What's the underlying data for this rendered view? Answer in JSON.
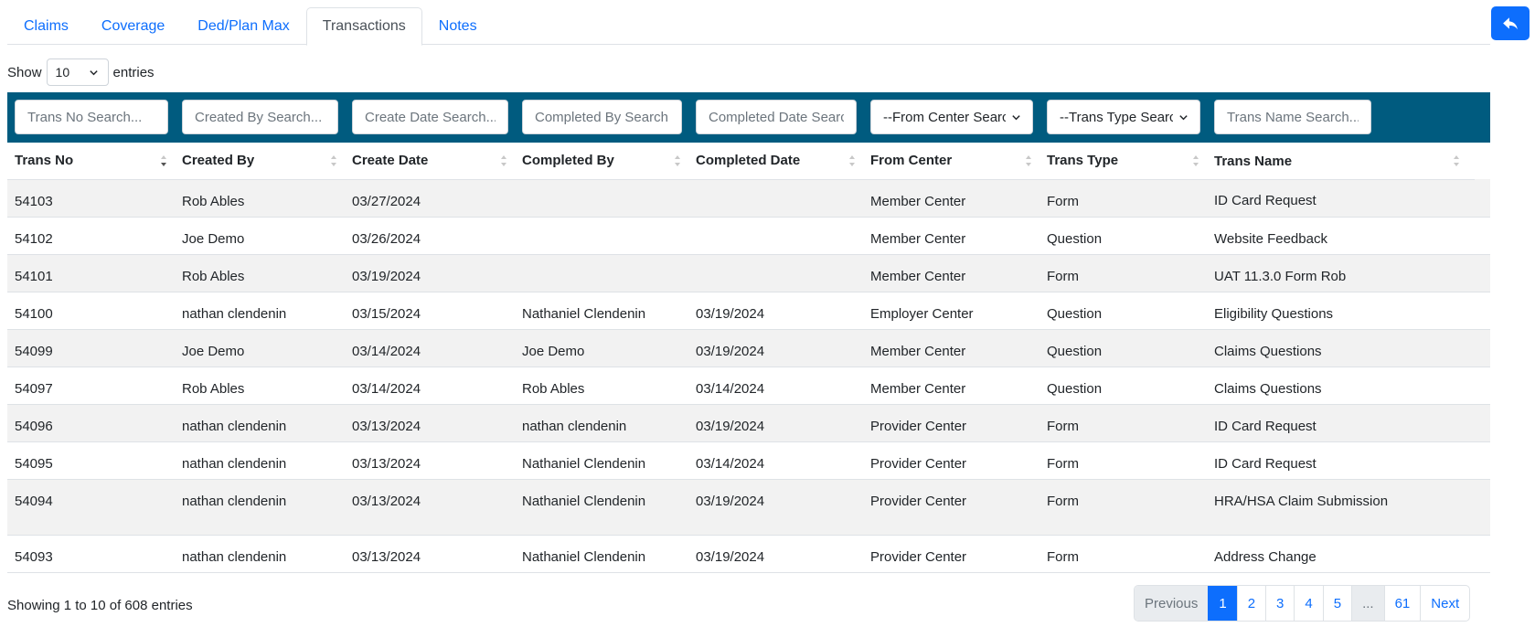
{
  "tabs": [
    {
      "label": "Claims"
    },
    {
      "label": "Coverage"
    },
    {
      "label": "Ded/Plan Max"
    },
    {
      "label": "Transactions"
    },
    {
      "label": "Notes"
    }
  ],
  "length_menu": {
    "show_label": "Show",
    "value": "10",
    "entries_label": "entries"
  },
  "filters": {
    "trans_no": "Trans No Search...",
    "created_by": "Created By Search...",
    "create_date": "Create Date Search...",
    "completed_by": "Completed By Search...",
    "completed_date": "Completed Date Search...",
    "from_center": "--From Center Search--",
    "trans_type": "--Trans Type Search--",
    "trans_name": "Trans Name Search..."
  },
  "columns": [
    "Trans No",
    "Created By",
    "Create Date",
    "Completed By",
    "Completed Date",
    "From Center",
    "Trans Type",
    "Trans Name"
  ],
  "rows": [
    [
      "54103",
      "Rob Ables",
      "03/27/2024",
      "",
      "",
      "Member Center",
      "Form",
      "ID Card Request"
    ],
    [
      "54102",
      "Joe Demo",
      "03/26/2024",
      "",
      "",
      "Member Center",
      "Question",
      "Website Feedback"
    ],
    [
      "54101",
      "Rob Ables",
      "03/19/2024",
      "",
      "",
      "Member Center",
      "Form",
      "UAT 11.3.0 Form Rob"
    ],
    [
      "54100",
      "nathan clendenin",
      "03/15/2024",
      "Nathaniel Clendenin",
      "03/19/2024",
      "Employer Center",
      "Question",
      "Eligibility Questions"
    ],
    [
      "54099",
      "Joe Demo",
      "03/14/2024",
      "Joe Demo",
      "03/19/2024",
      "Member Center",
      "Question",
      "Claims Questions"
    ],
    [
      "54097",
      "Rob Ables",
      "03/14/2024",
      "Rob Ables",
      "03/14/2024",
      "Member Center",
      "Question",
      "Claims Questions"
    ],
    [
      "54096",
      "nathan clendenin",
      "03/13/2024",
      "nathan clendenin",
      "03/19/2024",
      "Provider Center",
      "Form",
      "ID Card Request"
    ],
    [
      "54095",
      "nathan clendenin",
      "03/13/2024",
      "Nathaniel Clendenin",
      "03/14/2024",
      "Provider Center",
      "Form",
      "ID Card Request"
    ],
    [
      "54094",
      "nathan clendenin",
      "03/13/2024",
      "Nathaniel Clendenin",
      "03/19/2024",
      "Provider Center",
      "Form",
      "HRA/HSA Claim Submission"
    ],
    [
      "54093",
      "nathan clendenin",
      "03/13/2024",
      "Nathaniel Clendenin",
      "03/19/2024",
      "Provider Center",
      "Form",
      "Address Change"
    ]
  ],
  "footer": {
    "info": "Showing 1 to 10 of 608 entries",
    "pagination": {
      "previous": "Previous",
      "pages": [
        "1",
        "2",
        "3",
        "4",
        "5"
      ],
      "ellipsis": "...",
      "last": "61",
      "next": "Next"
    }
  },
  "colors": {
    "accent": "#0d6efd",
    "filter_bar": "#005b7f",
    "stripe": "#f2f2f2"
  }
}
